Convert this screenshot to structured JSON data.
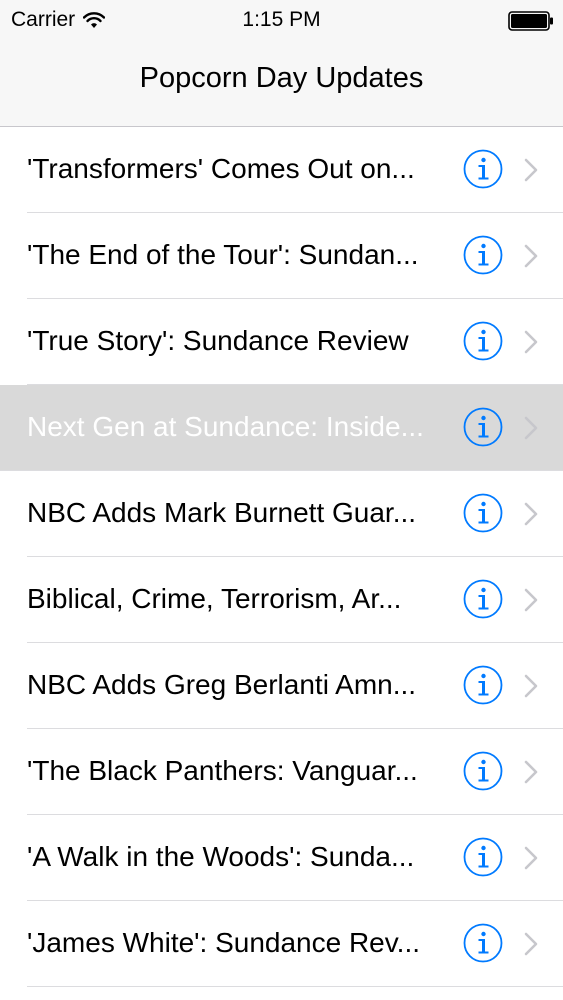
{
  "status_bar": {
    "carrier": "Carrier",
    "time": "1:15 PM",
    "wifi_icon": "wifi-icon",
    "battery_icon": "battery-full-icon"
  },
  "nav": {
    "title": "Popcorn Day Updates"
  },
  "rows": [
    {
      "title": "'Transformers' Comes Out on...",
      "selected": false
    },
    {
      "title": "'The End of the Tour': Sundan...",
      "selected": false
    },
    {
      "title": "'True Story': Sundance Review",
      "selected": false
    },
    {
      "title": "Next Gen at Sundance: Inside...",
      "selected": true
    },
    {
      "title": "NBC Adds Mark Burnett Guar...",
      "selected": false
    },
    {
      "title": "Biblical, Crime, Terrorism, Ar...",
      "selected": false
    },
    {
      "title": "NBC Adds Greg Berlanti Amn...",
      "selected": false
    },
    {
      "title": "'The Black Panthers: Vanguar...",
      "selected": false
    },
    {
      "title": "'A Walk in the Woods': Sunda...",
      "selected": false
    },
    {
      "title": "'James White': Sundance Rev...",
      "selected": false
    }
  ],
  "colors": {
    "accent": "#007aff",
    "chevron": "#c7c7cc",
    "selected_row": "#d9d9d9"
  }
}
